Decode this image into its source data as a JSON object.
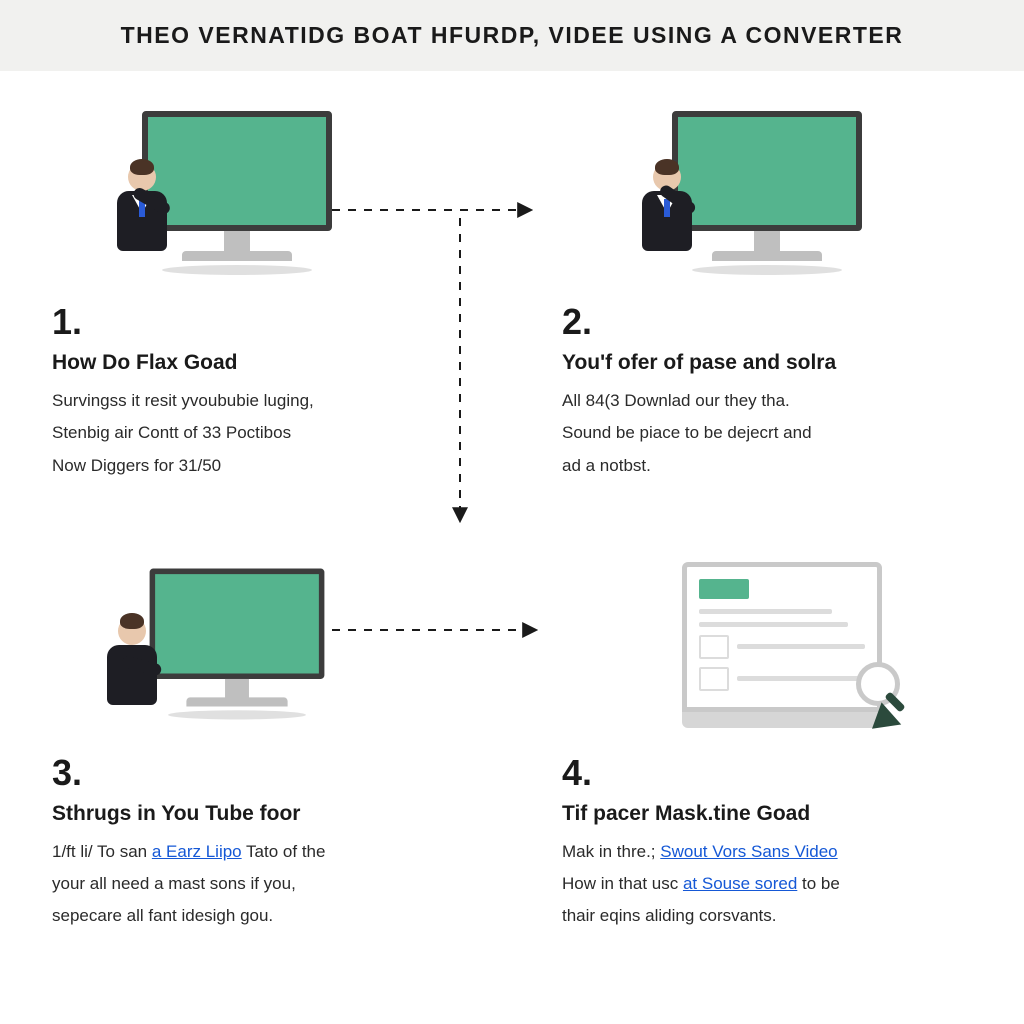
{
  "title": "THEO VERNATIDG BOAT HFURDP, VIDEE USING A CONVERTER",
  "steps": {
    "s1": {
      "num": "1.",
      "heading": "How Do Flax Goad",
      "line1": "Survingss it resit yvoububie luging,",
      "line2": "Stenbig air Contt of 33 Poctibos",
      "line3": "Now Diggers for 31/50"
    },
    "s2": {
      "num": "2.",
      "heading": "You'f ofer of pase and solra",
      "line1": "All 84(3 Downlad our they tha.",
      "line2": "Sound be piace to be dejecrt and",
      "line3": "ad a notbst."
    },
    "s3": {
      "num": "3.",
      "heading": "Sthrugs in You Tube foor",
      "prefix": "1/ft li/ To san ",
      "link": "a Earz Liipo",
      "after_link": " Tato of the",
      "line2": "your all need a mast sons if you,",
      "line3": "sepecare all fant idesigh gou."
    },
    "s4": {
      "num": "4.",
      "heading": "Tif pacer Mask.tine Goad",
      "prefix": "Mak in thre.; ",
      "link1": "Swout Vors Sans Video",
      "line2a": "How in that usc ",
      "link2": "at Souse sored",
      "line2b": " to be",
      "line3": "thair eqins aliding corsvants."
    }
  }
}
